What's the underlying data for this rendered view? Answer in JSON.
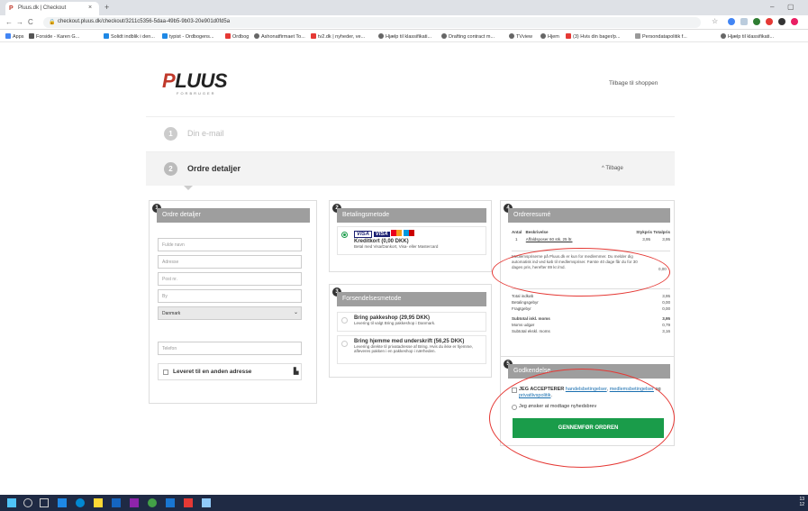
{
  "browser": {
    "tab_title": "Pluus.dk | Checkout",
    "tab_close": "×",
    "new_tab": "+",
    "win_min": "–",
    "win_max": "▢",
    "url": "checkout.pluus.dk/checkout/3211c5356-5daa-49b5-9b03-20e901d0fd5a",
    "back": "←",
    "forward": "→",
    "reload": "C",
    "bookmarks": [
      "Apps",
      "Forside - Karen G...",
      "Solidt indblik i den...",
      "typist - Ordbogens...",
      "Ordbog",
      "Ashonatfirmaet To...",
      "tv2.dk | nyheder, ve...",
      "Hjælp til klassifikati...",
      "Drafting contract m...",
      "TVview",
      "Hjem",
      "(3) Hvis din bager/p...",
      "Persondatapolitik f...",
      "Hjælp til klassifikati..."
    ]
  },
  "header": {
    "logo": "PLUUS",
    "logo_p": "P",
    "logo_rest": "LUUS",
    "logo_sub": "FORBRUGER",
    "back_to_shop": "Tilbage til shoppen"
  },
  "steps": [
    {
      "num": "1",
      "title": "Din e-mail"
    },
    {
      "num": "2",
      "title": "Ordre detaljer",
      "back": "^ Tilbage"
    }
  ],
  "order_details": {
    "badge": "1",
    "heading": "Ordre detaljer",
    "fields": [
      "Fulde navn",
      "Adresse",
      "Post nr.",
      "By"
    ],
    "country": "Danmark",
    "phone_placeholder": "Telefon",
    "deliver_other": "Leveret til en anden adresse"
  },
  "payment": {
    "badge": "2",
    "heading": "Betalingsmetode",
    "card_title": "Kreditkort (0,00 DKK)",
    "card_desc": "Betal med Visa/Dankort, Visa- eller Mastercard",
    "visa1": "VISA",
    "visa2": "VISA"
  },
  "shipping": {
    "badge": "3",
    "heading": "Forsendelsesmetode",
    "options": [
      {
        "title": "Bring pakkeshop (29,95 DKK)",
        "desc": "Levering til valgt Bring pakkeshop i Danmark."
      },
      {
        "title": "Bring hjemme med underskrift (56,25 DKK)",
        "desc": "Levering direkte til privatadresse af Bring. Hvis du ikke er hjemme, afleveres pakken i en pakkeshop i nærheden."
      }
    ]
  },
  "summary": {
    "badge": "4",
    "heading": "Ordreresumé",
    "col_qty": "Antal",
    "col_desc": "Beskrivelse",
    "col_unit": "Stykpris",
    "col_total": "Totalpris",
    "item_qty": "1",
    "item_name": "Affaldsposer 60 stk. 25 ltr.",
    "item_unit": "3,95",
    "item_total": "3,95",
    "membership_text": "Medlemspriserne på Pluus.dk er kun for medlemmer. Du melder dig automatisk ind ved køb til medlemspriser. Første 40 dage får du for 30 dages pris, herefter 89 kr./md.",
    "membership_price": "0,00",
    "rows": [
      {
        "label": "Total indkøb",
        "value": "3,95",
        "bold": false
      },
      {
        "label": "Betalingsgebyr",
        "value": "0,00",
        "bold": false
      },
      {
        "label": "Fragtgebyr",
        "value": "0,00",
        "bold": false
      },
      {
        "label": "Subtotal inkl. moms",
        "value": "3,95",
        "bold": true
      },
      {
        "label": "Moms udgør",
        "value": "0,79",
        "bold": false
      },
      {
        "label": "Subtotal ekskl. moms",
        "value": "3,16",
        "bold": false
      }
    ]
  },
  "terms": {
    "badge": "5",
    "heading": "Godkendelse",
    "accept_bold": "JEG ACCEPTERER",
    "accept_link1": "handelsbetingelser",
    "accept_sep1": ", ",
    "accept_link2": "medlemsbetingelser",
    "accept_og": " og ",
    "accept_link3": "privatlivspolitik",
    "accept_end": ".",
    "newsletter": "Jeg ønsker at modtage nyhedsbrev",
    "submit": "GENNEMFØR ORDREN"
  },
  "taskbar": {
    "clock_time": "13",
    "clock_date": "12"
  },
  "colors": {
    "accent_green": "#1a9c4a",
    "logo_red": "#c0392b",
    "panel_head": "#9e9e9e",
    "annotation_red": "#e53935"
  }
}
